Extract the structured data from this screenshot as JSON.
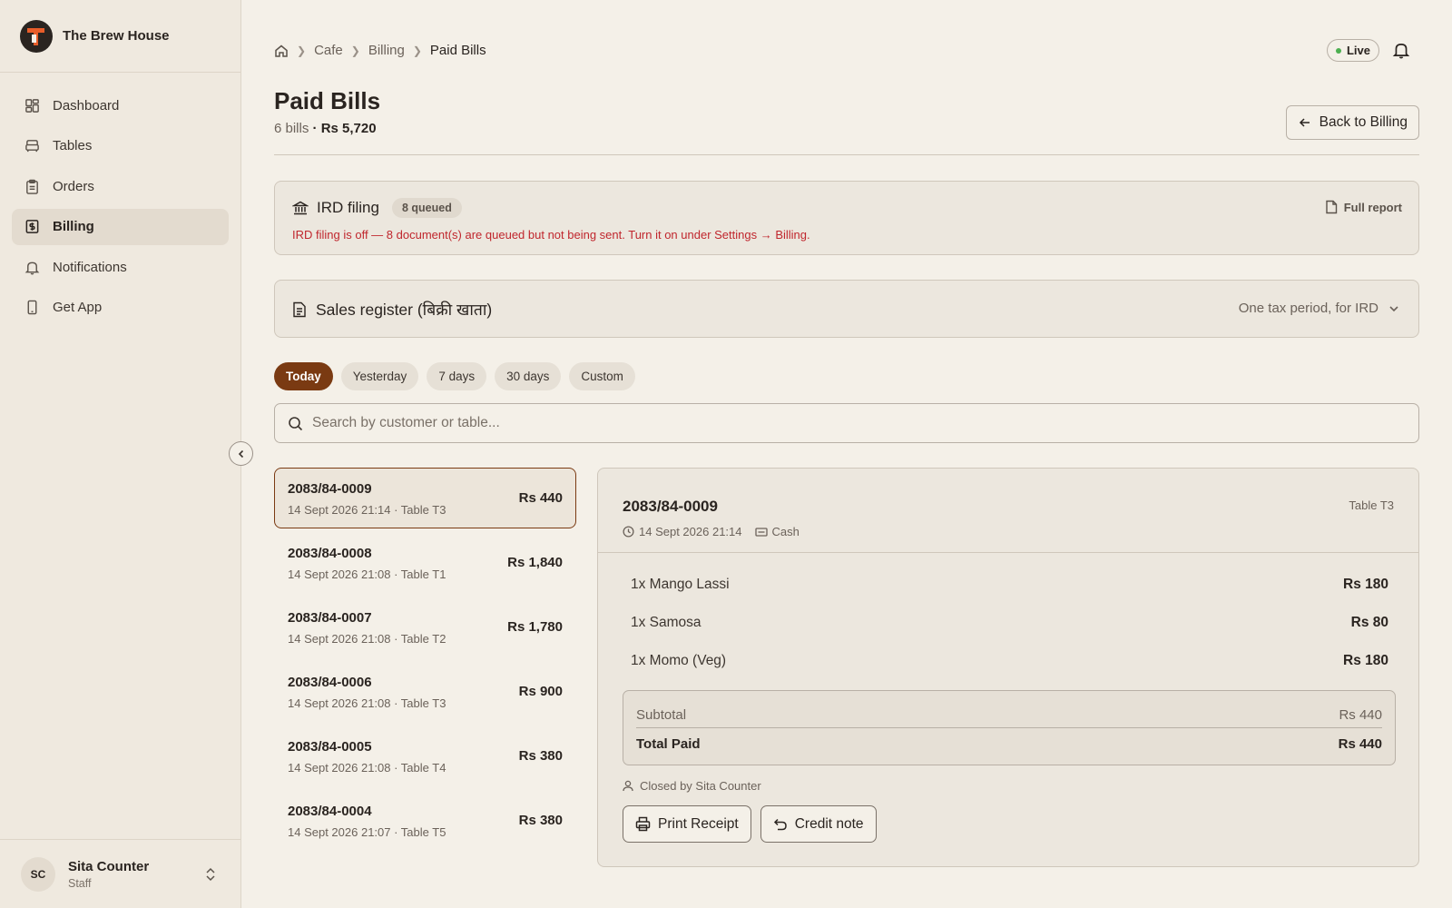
{
  "brand": {
    "name": "The Brew House"
  },
  "sidebar": {
    "items": [
      {
        "label": "Dashboard",
        "icon": "grid-icon"
      },
      {
        "label": "Tables",
        "icon": "sofa-icon"
      },
      {
        "label": "Orders",
        "icon": "clipboard-icon"
      },
      {
        "label": "Billing",
        "icon": "receipt-icon",
        "active": true
      },
      {
        "label": "Notifications",
        "icon": "bell-icon"
      },
      {
        "label": "Get App",
        "icon": "phone-icon"
      }
    ]
  },
  "user": {
    "initials": "SC",
    "name": "Sita Counter",
    "role": "Staff"
  },
  "breadcrumb": {
    "items": [
      "Cafe",
      "Billing",
      "Paid Bills"
    ]
  },
  "status": {
    "live_label": "Live",
    "live_color": "#4caf50"
  },
  "page": {
    "title": "Paid Bills",
    "bill_count": "6 bills",
    "separator": " · ",
    "total": "Rs 5,720",
    "back_label": "Back to Billing"
  },
  "ird": {
    "title": "IRD filing",
    "queued_badge": "8 queued",
    "warning": "IRD filing is off — 8 document(s) are queued but not being sent. Turn it on under Settings → Billing.",
    "full_report_label": "Full report"
  },
  "sales_register": {
    "title": "Sales register (बिक्री खाता)",
    "subtitle": "One tax period, for IRD"
  },
  "filters": {
    "options": [
      "Today",
      "Yesterday",
      "7 days",
      "30 days",
      "Custom"
    ],
    "selected": "Today"
  },
  "search": {
    "placeholder": "Search by customer or table...",
    "value": ""
  },
  "bills": [
    {
      "number": "2083/84-0009",
      "meta": "14 Sept 2026 21:14 · Table T3",
      "amount": "Rs 440"
    },
    {
      "number": "2083/84-0008",
      "meta": "14 Sept 2026 21:08 · Table T1",
      "amount": "Rs 1,840"
    },
    {
      "number": "2083/84-0007",
      "meta": "14 Sept 2026 21:08 · Table T2",
      "amount": "Rs 1,780"
    },
    {
      "number": "2083/84-0006",
      "meta": "14 Sept 2026 21:08 · Table T3",
      "amount": "Rs 900"
    },
    {
      "number": "2083/84-0005",
      "meta": "14 Sept 2026 21:08 · Table T4",
      "amount": "Rs 380"
    },
    {
      "number": "2083/84-0004",
      "meta": "14 Sept 2026 21:07 · Table T5",
      "amount": "Rs 380"
    }
  ],
  "detail": {
    "number": "2083/84-0009",
    "datetime": "14 Sept 2026 21:14",
    "payment": "Cash",
    "table": "Table T3",
    "items": [
      {
        "name": "1x Mango Lassi",
        "price": "Rs 180"
      },
      {
        "name": "1x Samosa",
        "price": "Rs 80"
      },
      {
        "name": "1x Momo (Veg)",
        "price": "Rs 180"
      }
    ],
    "subtotal_label": "Subtotal",
    "subtotal": "Rs 440",
    "total_label": "Total Paid",
    "total": "Rs 440",
    "closed_by": "Closed by Sita Counter",
    "print_label": "Print Receipt",
    "credit_label": "Credit note"
  },
  "colors": {
    "accent": "#7a3a12",
    "warning": "#c0262d",
    "background": "#f4f0e8"
  }
}
